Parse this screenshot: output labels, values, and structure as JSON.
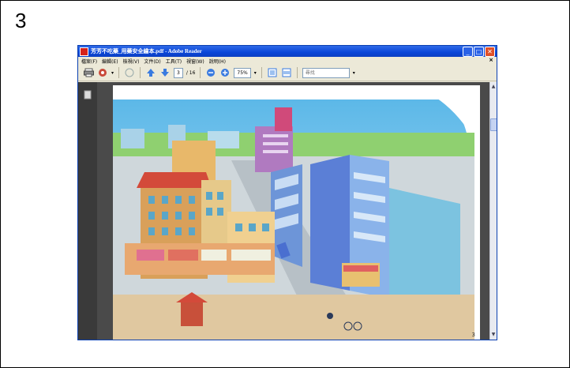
{
  "slide": {
    "number": "3"
  },
  "window": {
    "title": "芳芳不吃藥_用藥安全繪本.pdf - Adobe Reader",
    "controls": {
      "minimize": "_",
      "maximize": "□",
      "close": "✕"
    }
  },
  "menubar": {
    "items": [
      {
        "label": "檔案(F)"
      },
      {
        "label": "編輯(E)"
      },
      {
        "label": "檢視(V)"
      },
      {
        "label": "文件(D)"
      },
      {
        "label": "工具(T)"
      },
      {
        "label": "視窗(W)"
      },
      {
        "label": "說明(H)"
      }
    ],
    "close": "×"
  },
  "toolbar": {
    "page_current": "3",
    "page_total": "/ 16",
    "zoom": "75%",
    "search_placeholder": "尋找"
  },
  "page": {
    "corner_number": "3"
  },
  "colors": {
    "titlebar": "#0a46d8",
    "chrome": "#ece9d8"
  }
}
